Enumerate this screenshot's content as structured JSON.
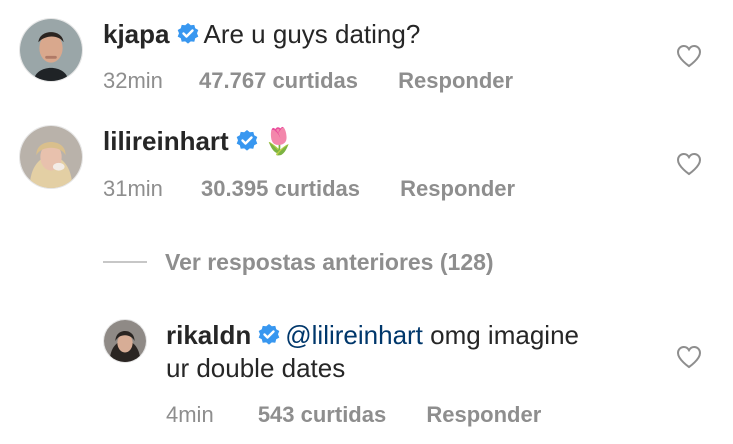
{
  "comments": [
    {
      "username": "kjapa",
      "verified": true,
      "text": "Are u guys dating?",
      "time": "32min",
      "likes": "47.767 curtidas",
      "reply": "Responder"
    },
    {
      "username": "lilireinhart",
      "verified": true,
      "text": "🌷",
      "time": "31min",
      "likes": "30.395 curtidas",
      "reply": "Responder"
    }
  ],
  "view_replies": {
    "label": "Ver respostas anteriores (128)"
  },
  "reply": {
    "username": "rikaldn",
    "verified": true,
    "mention": "@lilireinhart",
    "text_line1": " omg imagine",
    "text_line2": "ur double dates",
    "time": "4min",
    "likes": "543 curtidas",
    "reply": "Responder"
  },
  "colors": {
    "verified_blue": "#3897f0",
    "mention_blue": "#00376b",
    "meta_gray": "#8e8e8e"
  },
  "icons": [
    "verified-badge-icon",
    "heart-outline-icon"
  ]
}
